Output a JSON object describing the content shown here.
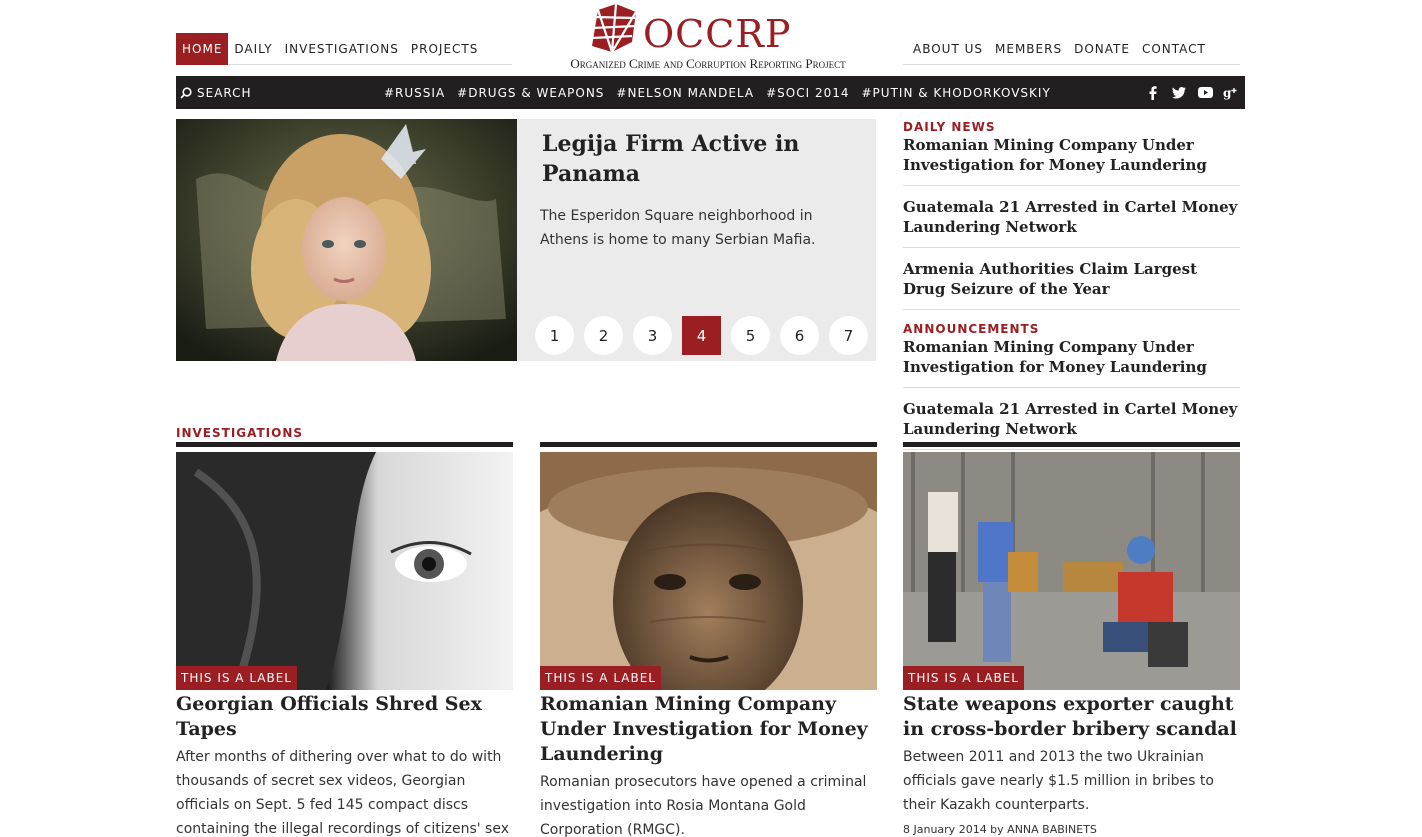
{
  "nav": {
    "left": [
      "HOME",
      "DAILY",
      "INVESTIGATIONS",
      "PROJECTS"
    ],
    "right": [
      "ABOUT US",
      "MEMBERS",
      "DONATE",
      "CONTACT"
    ]
  },
  "logo": {
    "name": "OCCRP",
    "tagline": "Organized Crime and Corruption Reporting Project",
    "color": "#9a1e22"
  },
  "bar": {
    "search_label": "SEARCH",
    "tags": [
      "#RUSSIA",
      "#DRUGS & WEAPONS",
      "#NELSON MANDELA",
      "#SOCI 2014",
      "#PUTIN & KHODORKOVSKIY"
    ],
    "social_icons": [
      "facebook-icon",
      "twitter-icon",
      "youtube-icon",
      "google-plus-icon"
    ]
  },
  "hero": {
    "title": "Legija Firm Active in Panama",
    "description": "The Esperidon Square neighborhood in Athens is home to many Serbian Mafia.",
    "pages": [
      "1",
      "2",
      "3",
      "4",
      "5",
      "6",
      "7"
    ],
    "active_page": "4"
  },
  "sidebar": {
    "daily_news_heading": "DAILY NEWS",
    "daily_news": [
      "Romanian Mining Company Under Investigation for Money Laundering",
      "Guatemala 21 Arrested in Cartel Money Laundering Network",
      "Armenia Authorities Claim Largest Drug Seizure of the Year"
    ],
    "announcements_heading": "ANNOUNCEMENTS",
    "announcements": [
      "Romanian Mining Company Under Investigation for Money Laundering",
      "Guatemala 21 Arrested in Cartel Money Laundering Network"
    ]
  },
  "investigations": {
    "heading": "INVESTIGATIONS",
    "cards": [
      {
        "label": "THIS IS A LABEL",
        "title": "Georgian Officials Shred Sex Tapes",
        "description": "After months of dithering over what to do with thousands of secret sex videos, Georgian officials on Sept. 5 fed 145 compact discs containing the illegal recordings of citizens' sex"
      },
      {
        "label": "THIS IS A LABEL",
        "title": "Romanian Mining Company Under Investigation for Money Laundering",
        "description": "Romanian prosecutors have opened a criminal investigation into Rosia Montana Gold Corporation (RMGC)."
      },
      {
        "label": "THIS IS A LABEL",
        "title": "State weapons exporter caught in cross-border bribery scandal",
        "description": "Between 2011 and 2013 the two Ukrainian officials gave nearly $1.5 million in bribes to their Kazakh counterparts.",
        "meta": "8 January 2014  by  ANNA BABINETS"
      }
    ]
  }
}
